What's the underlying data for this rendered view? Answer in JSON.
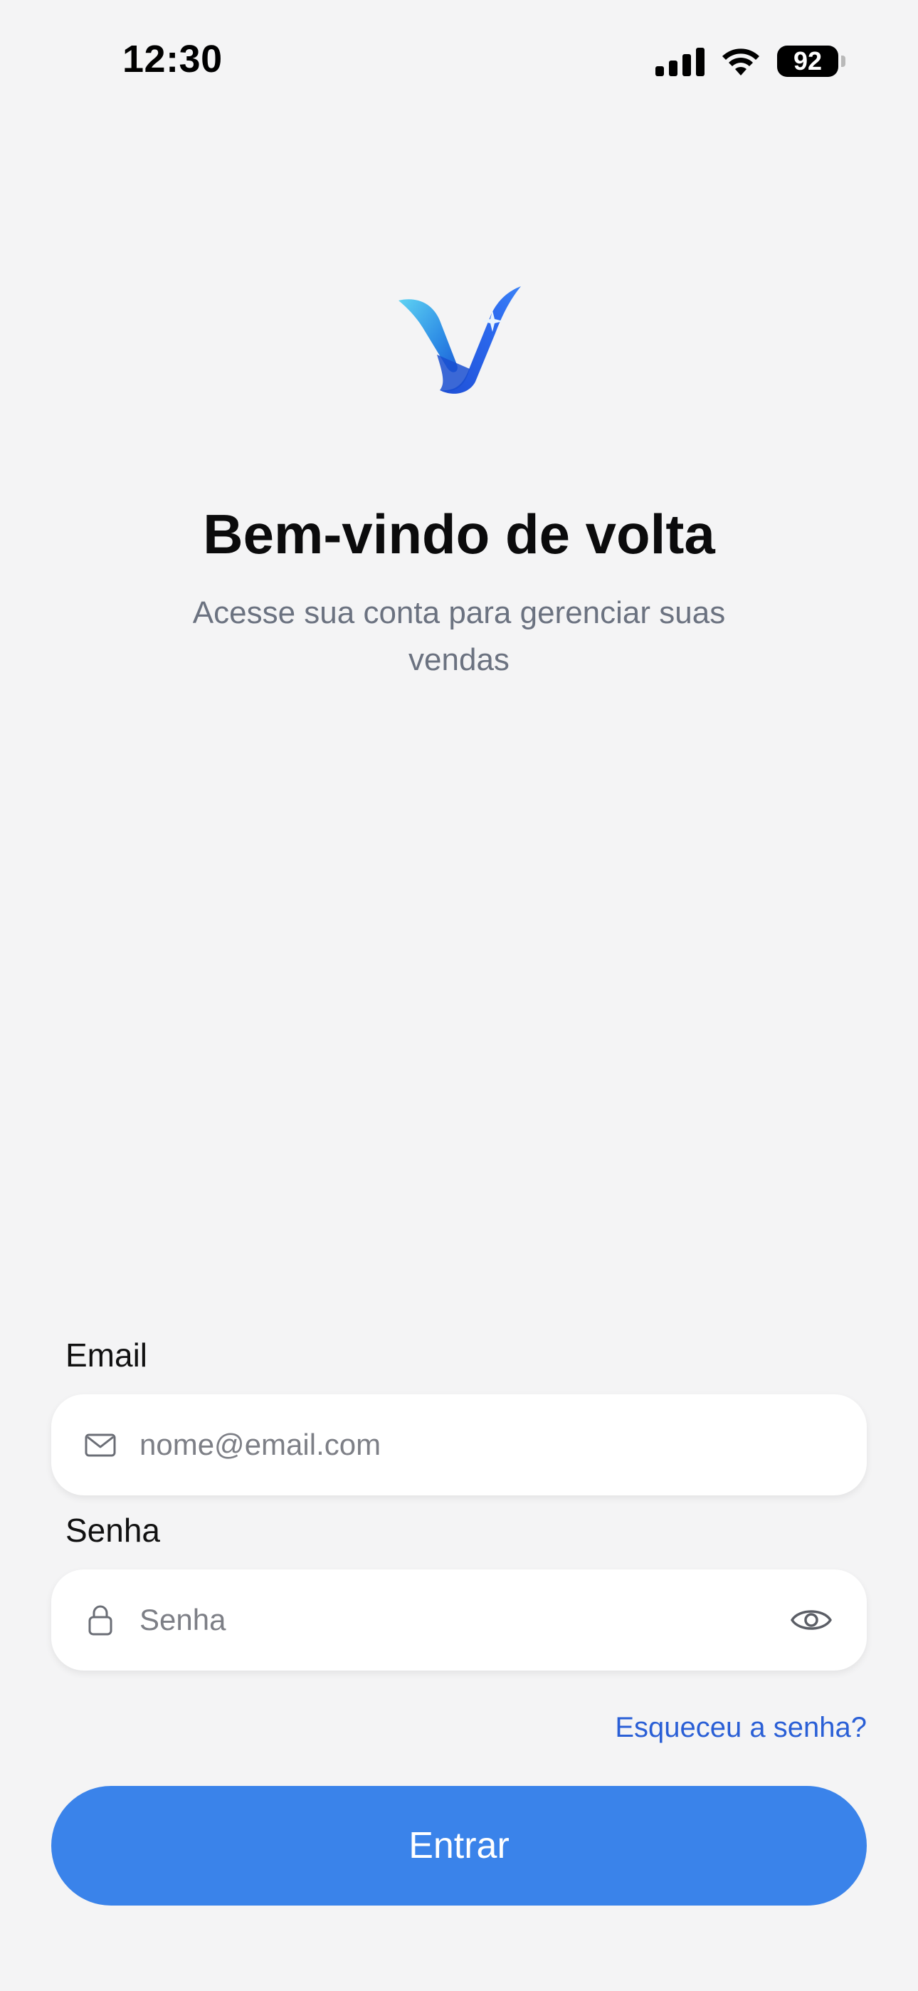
{
  "status_bar": {
    "time": "12:30",
    "battery": "92",
    "icons": [
      "cellular-signal-icon",
      "wifi-icon",
      "battery-icon"
    ]
  },
  "header": {
    "logo_icon": "brand-v-logo-icon",
    "title": "Bem-vindo de volta",
    "subtitle": "Acesse sua conta para gerenciar suas vendas"
  },
  "form": {
    "email": {
      "label": "Email",
      "placeholder": "nome@email.com",
      "value": "",
      "icon": "mail-icon"
    },
    "password": {
      "label": "Senha",
      "placeholder": "Senha",
      "value": "",
      "icon": "lock-icon",
      "toggle_icon": "eye-icon"
    },
    "forgot_link": "Esqueceu a senha?",
    "submit_label": "Entrar"
  },
  "colors": {
    "background": "#f4f4f5",
    "accent": "#3a83ea",
    "link": "#2a5fd6",
    "muted_text": "#6b7280"
  }
}
